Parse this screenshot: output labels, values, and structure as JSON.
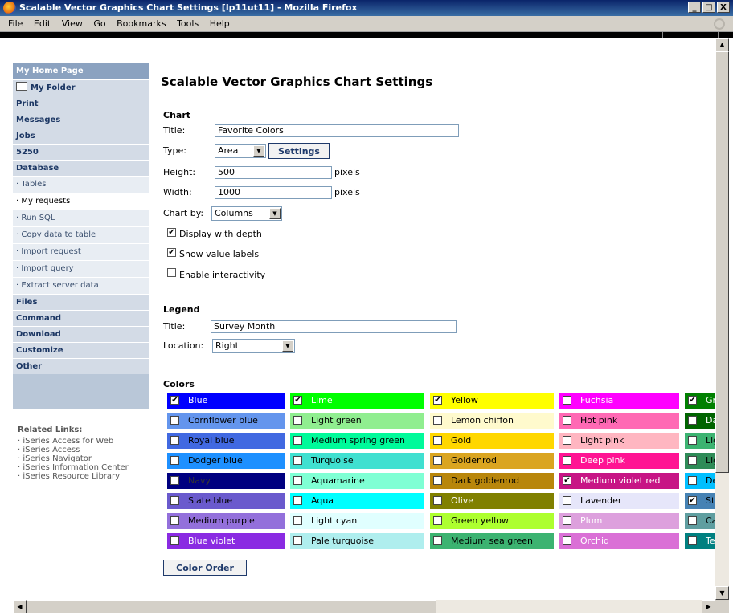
{
  "window": {
    "title": "Scalable Vector Graphics Chart Settings [lp11ut11] - Mozilla Firefox",
    "buttons": [
      "_",
      "□",
      "X"
    ]
  },
  "menu": [
    "File",
    "Edit",
    "View",
    "Go",
    "Bookmarks",
    "Tools",
    "Help"
  ],
  "sidebar": {
    "home": "My Home Page",
    "folder": "My Folder",
    "print": "Print",
    "messages": "Messages",
    "jobs": "Jobs",
    "s5250": "5250",
    "database": "Database",
    "db_items": [
      "· Tables",
      "· My requests",
      "· Run SQL",
      "· Copy data to table",
      "· Import request",
      "· Import query",
      "· Extract server data"
    ],
    "files": "Files",
    "command": "Command",
    "download": "Download",
    "customize": "Customize",
    "other": "Other"
  },
  "related": {
    "heading": "Related Links:",
    "links": [
      "· iSeries Access for Web",
      "· iSeries Access",
      "· iSeries Navigator",
      "· iSeries Information Center",
      "· iSeries Resource Library"
    ]
  },
  "page": {
    "title": "Scalable Vector Graphics Chart Settings"
  },
  "chart": {
    "heading": "Chart",
    "title_label": "Title:",
    "title_value": "Favorite Colors",
    "type_label": "Type:",
    "type_value": "Area",
    "settings_button": "Settings",
    "height_label": "Height:",
    "height_value": "500",
    "height_unit": "pixels",
    "width_label": "Width:",
    "width_value": "1000",
    "width_unit": "pixels",
    "chartby_label": "Chart by:",
    "chartby_value": "Columns",
    "opt_depth": "Display with depth",
    "opt_depth_checked": true,
    "opt_values": "Show value labels",
    "opt_values_checked": true,
    "opt_interact": "Enable interactivity",
    "opt_interact_checked": false
  },
  "legend": {
    "heading": "Legend",
    "title_label": "Title:",
    "title_value": "Survey Month",
    "location_label": "Location:",
    "location_value": "Right"
  },
  "colors": {
    "heading": "Colors",
    "order_button": "Color Order",
    "rows": [
      [
        {
          "n": "Blue",
          "c": "#0000ff",
          "t": "#fff",
          "k": true
        },
        {
          "n": "Lime",
          "c": "#00ff00",
          "t": "#fff",
          "k": true
        },
        {
          "n": "Yellow",
          "c": "#ffff00",
          "t": "#000",
          "k": true
        },
        {
          "n": "Fuchsia",
          "c": "#ff00ff",
          "t": "#fff",
          "k": false
        },
        {
          "n": "Gr",
          "c": "#008000",
          "t": "#fff",
          "k": true
        }
      ],
      [
        {
          "n": "Cornflower blue",
          "c": "#6495ed",
          "t": "#000",
          "k": false
        },
        {
          "n": "Light green",
          "c": "#90ee90",
          "t": "#000",
          "k": false
        },
        {
          "n": "Lemon chiffon",
          "c": "#fffacd",
          "t": "#000",
          "k": false
        },
        {
          "n": "Hot pink",
          "c": "#ff69b4",
          "t": "#000",
          "k": false
        },
        {
          "n": "Da",
          "c": "#006400",
          "t": "#fff",
          "k": false
        }
      ],
      [
        {
          "n": "Royal blue",
          "c": "#4169e1",
          "t": "#000",
          "k": false
        },
        {
          "n": "Medium spring green",
          "c": "#00fa9a",
          "t": "#000",
          "k": false
        },
        {
          "n": "Gold",
          "c": "#ffd700",
          "t": "#000",
          "k": false
        },
        {
          "n": "Light pink",
          "c": "#ffb6c1",
          "t": "#000",
          "k": false
        },
        {
          "n": "Lig",
          "c": "#3cb371",
          "t": "#000",
          "k": false
        }
      ],
      [
        {
          "n": "Dodger blue",
          "c": "#1e90ff",
          "t": "#000",
          "k": false
        },
        {
          "n": "Turquoise",
          "c": "#40e0d0",
          "t": "#000",
          "k": false
        },
        {
          "n": "Goldenrod",
          "c": "#daa520",
          "t": "#000",
          "k": false
        },
        {
          "n": "Deep pink",
          "c": "#ff1493",
          "t": "#fff",
          "k": false
        },
        {
          "n": "Lig",
          "c": "#2e8b57",
          "t": "#000",
          "k": false
        }
      ],
      [
        {
          "n": "Navy",
          "c": "#000080",
          "t": "#333",
          "k": false
        },
        {
          "n": "Aquamarine",
          "c": "#7fffd4",
          "t": "#000",
          "k": false
        },
        {
          "n": "Dark goldenrod",
          "c": "#b8860b",
          "t": "#000",
          "k": false
        },
        {
          "n": "Medium violet red",
          "c": "#c71585",
          "t": "#fff",
          "k": true
        },
        {
          "n": "De",
          "c": "#00bfff",
          "t": "#000",
          "k": false
        }
      ],
      [
        {
          "n": "Slate blue",
          "c": "#6a5acd",
          "t": "#000",
          "k": false
        },
        {
          "n": "Aqua",
          "c": "#00ffff",
          "t": "#000",
          "k": false
        },
        {
          "n": "Olive",
          "c": "#808000",
          "t": "#fff",
          "k": false
        },
        {
          "n": "Lavender",
          "c": "#e6e6fa",
          "t": "#000",
          "k": false
        },
        {
          "n": "Ste",
          "c": "#4682b4",
          "t": "#000",
          "k": true
        }
      ],
      [
        {
          "n": "Medium purple",
          "c": "#9370db",
          "t": "#000",
          "k": false
        },
        {
          "n": "Light cyan",
          "c": "#e0ffff",
          "t": "#000",
          "k": false
        },
        {
          "n": "Green yellow",
          "c": "#adff2f",
          "t": "#000",
          "k": false
        },
        {
          "n": "Plum",
          "c": "#dda0dd",
          "t": "#fff",
          "k": false
        },
        {
          "n": "Ca",
          "c": "#5f9ea0",
          "t": "#000",
          "k": false
        }
      ],
      [
        {
          "n": "Blue violet",
          "c": "#8a2be2",
          "t": "#fff",
          "k": false
        },
        {
          "n": "Pale turquoise",
          "c": "#afeeee",
          "t": "#000",
          "k": false
        },
        {
          "n": "Medium sea green",
          "c": "#3cb371",
          "t": "#000",
          "k": false
        },
        {
          "n": "Orchid",
          "c": "#da70d6",
          "t": "#fff",
          "k": false
        },
        {
          "n": "Te",
          "c": "#008080",
          "t": "#fff",
          "k": false
        }
      ]
    ]
  }
}
